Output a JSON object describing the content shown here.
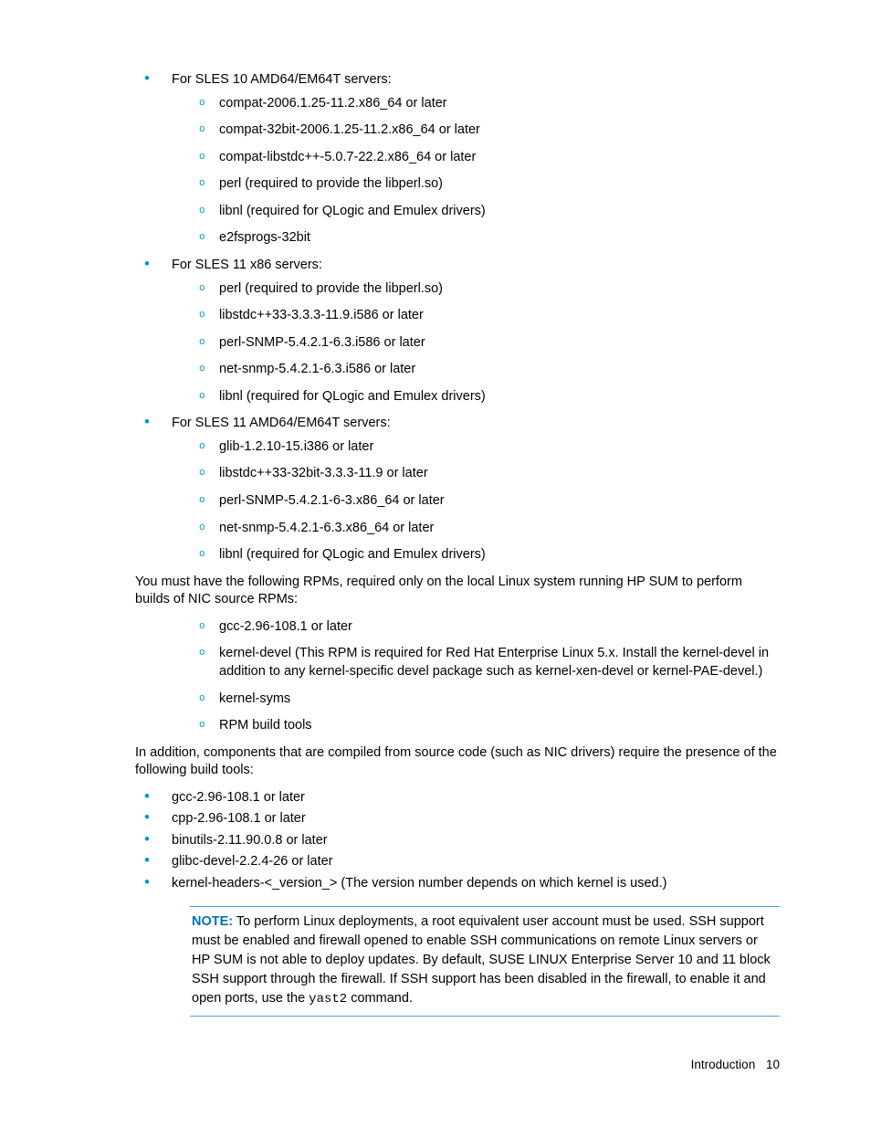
{
  "sections": [
    {
      "label": "For SLES 10 AMD64/EM64T servers:",
      "items": [
        "compat-2006.1.25-11.2.x86_64 or later",
        "compat-32bit-2006.1.25-11.2.x86_64 or later",
        "compat-libstdc++-5.0.7-22.2.x86_64 or later",
        "perl (required to provide the libperl.so)",
        "libnl (required for QLogic and Emulex drivers)",
        "e2fsprogs-32bit"
      ]
    },
    {
      "label": "For SLES 11 x86 servers:",
      "items": [
        "perl (required to provide the libperl.so)",
        "libstdc++33-3.3.3-11.9.i586 or later",
        "perl-SNMP-5.4.2.1-6.3.i586 or later",
        "net-snmp-5.4.2.1-6.3.i586 or later",
        "libnl (required for QLogic and Emulex drivers)"
      ]
    },
    {
      "label": "For SLES 11 AMD64/EM64T servers:",
      "items": [
        "glib-1.2.10-15.i386 or later",
        "libstdc++33-32bit-3.3.3-11.9 or later",
        "perl-SNMP-5.4.2.1-6-3.x86_64 or later",
        "net-snmp-5.4.2.1-6.3.x86_64 or later",
        "libnl (required for QLogic and Emulex drivers)"
      ]
    }
  ],
  "para1": "You must have the following RPMs, required only on the local Linux system running HP SUM to perform builds of NIC source RPMs:",
  "orphan_items": [
    "gcc-2.96-108.1 or later",
    "kernel-devel (This RPM is required for Red Hat Enterprise Linux 5.x. Install the kernel-devel in addition to any kernel-specific devel package such as kernel-xen-devel or kernel-PAE-devel.)",
    "kernel-syms",
    "RPM build tools"
  ],
  "para2": "In addition, components that are compiled from source code (such as NIC drivers) require the presence of the following build tools:",
  "build_tools": [
    "gcc-2.96-108.1 or later",
    "cpp-2.96-108.1 or later",
    "binutils-2.11.90.0.8 or later",
    "glibc-devel-2.2.4-26 or later",
    "kernel-headers-<_version_> (The version number depends on which kernel is used.)"
  ],
  "note": {
    "label": "NOTE:",
    "text_before": "  To perform Linux deployments, a root equivalent user account must be used. SSH support must be enabled and firewall opened to enable SSH communications on remote Linux servers or HP SUM is not able to deploy updates. By default, SUSE LINUX Enterprise Server 10 and 11 block SSH support through the firewall. If SSH support has been disabled in the firewall, to enable it and open ports, use the ",
    "command": "yast2",
    "text_after": " command."
  },
  "footer": {
    "section": "Introduction",
    "page": "10"
  }
}
